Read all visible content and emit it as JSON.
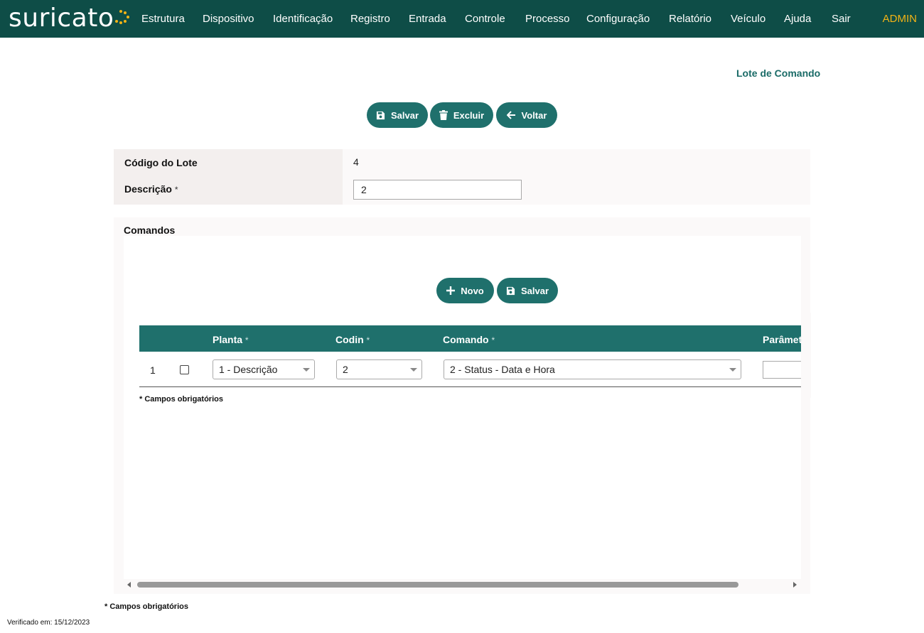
{
  "app": {
    "logo_text": "suricato",
    "user": "ADMIN"
  },
  "nav": {
    "items": [
      "Estrutura",
      "Dispositivo",
      "Identificação",
      "Registro",
      "Entrada",
      "Controle",
      "Processo",
      "Configuração",
      "Relatório",
      "Veículo",
      "Ajuda",
      "Sair"
    ]
  },
  "page": {
    "title": "Lote de Comando"
  },
  "toolbar": {
    "save_label": "Salvar",
    "delete_label": "Excluir",
    "back_label": "Voltar"
  },
  "form": {
    "codigo_label": "Código do Lote",
    "codigo_value": "4",
    "descricao_label": "Descrição",
    "descricao_value": "2",
    "required_marker": "*"
  },
  "commands": {
    "title": "Comandos",
    "new_label": "Novo",
    "save_label": "Salvar",
    "columns": [
      "Planta",
      "Codin",
      "Comando",
      "Parâmet"
    ],
    "rows": [
      {
        "index": "1",
        "checked": false,
        "planta": "1 - Descrição",
        "codin": "2",
        "comando": "2 - Status - Data e Hora",
        "parametro": ""
      }
    ],
    "required_note": "* Campos obrigatórios"
  },
  "footer": {
    "required_note": "* Campos obrigatórios",
    "verified": "Verificado em: 15/12/2023"
  },
  "colors": {
    "navbar": "#0e4d47",
    "accent": "#1f706c",
    "admin": "#f2b316",
    "title": "#1a6b67"
  }
}
